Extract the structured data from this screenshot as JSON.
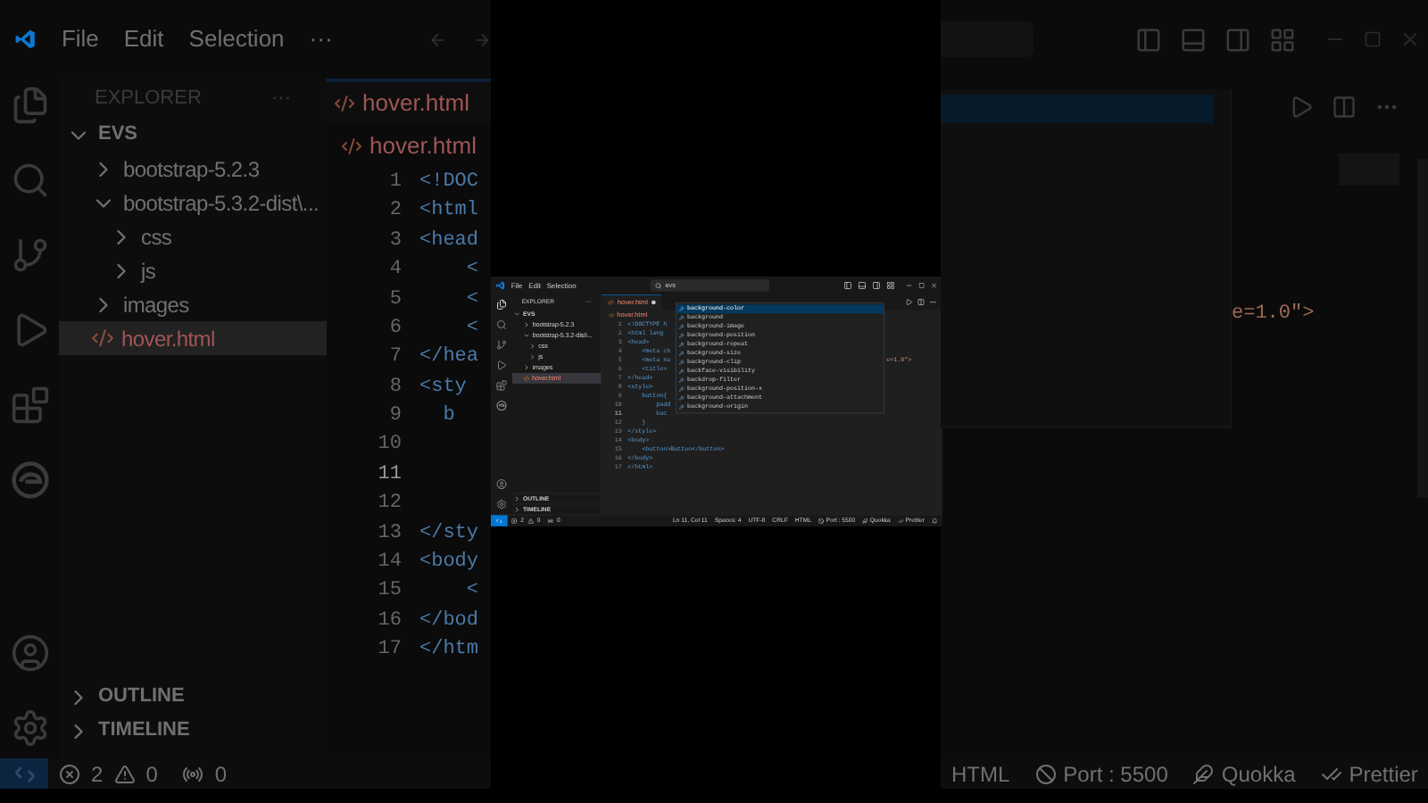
{
  "background": {
    "menu": [
      "File",
      "Edit",
      "Selection",
      "···"
    ],
    "explorer": {
      "title": "EXPLORER",
      "more": "···",
      "workspace": "EVS",
      "workspace_expanded": true,
      "items": [
        {
          "label": "bootstrap-5.2.3",
          "kind": "folder",
          "expanded": false,
          "selected": false
        },
        {
          "label": "bootstrap-5.3.2-dist\\...",
          "kind": "folder",
          "expanded": true,
          "selected": false,
          "children": [
            {
              "label": "css",
              "kind": "folder",
              "expanded": false,
              "selected": false
            },
            {
              "label": "js",
              "kind": "folder",
              "expanded": false,
              "selected": false
            }
          ]
        },
        {
          "label": "images",
          "kind": "folder",
          "expanded": false,
          "selected": false
        },
        {
          "label": "hover.html",
          "kind": "file",
          "has_errors": true,
          "selected": true
        }
      ]
    },
    "sections": [
      "OUTLINE",
      "TIMELINE"
    ],
    "tab": "hover.html",
    "breadcrumb": "hover.html",
    "lines": [
      {
        "number": "1",
        "code": "<!DOC",
        "current": false
      },
      {
        "number": "2",
        "code": "<html",
        "current": false
      },
      {
        "number": "3",
        "code": "<head",
        "current": false
      },
      {
        "number": "4",
        "code": "    <",
        "current": false
      },
      {
        "number": "5",
        "code": "    <",
        "current": false
      },
      {
        "number": "6",
        "code": "    <",
        "current": false
      },
      {
        "number": "7",
        "code": "</hea",
        "current": false
      },
      {
        "number": "8",
        "code": "<sty",
        "current": false
      },
      {
        "number": "9",
        "code": "  b",
        "current": false
      },
      {
        "number": "10",
        "current": false
      },
      {
        "number": "11",
        "current": true
      },
      {
        "number": "12",
        "current": false
      },
      {
        "number": "13",
        "code": "</sty",
        "current": false
      },
      {
        "number": "14",
        "code": "<body",
        "current": false
      },
      {
        "number": "15",
        "code": "    <",
        "current": false
      },
      {
        "number": "16",
        "code": "</bod",
        "current": false
      },
      {
        "number": "17",
        "code": "</htm",
        "current": false
      }
    ],
    "code_tail": "e=1.0\">",
    "status_left": {
      "errors": "2",
      "warnings": "0",
      "ports": "0"
    },
    "status_right": [
      {
        "kind": "language",
        "text": "HTML"
      },
      {
        "kind": "port",
        "text": "Port : 5500"
      },
      {
        "kind": "quokka",
        "text": "Quokka"
      },
      {
        "kind": "prettier",
        "text": "Prettier"
      }
    ]
  },
  "window": {
    "menu": [
      "File",
      "Edit",
      "Selection"
    ],
    "search": "evs",
    "explorer": {
      "title": "EXPLORER",
      "more": "···",
      "workspace": "EVS",
      "workspace_expanded": true,
      "items": [
        {
          "label": "bootstrap-5.2.3",
          "kind": "folder",
          "expanded": false,
          "selected": false
        },
        {
          "label": "bootstrap-5.3.2-dist\\...",
          "kind": "folder",
          "expanded": true,
          "selected": false,
          "children": [
            {
              "label": "css",
              "kind": "folder",
              "expanded": false,
              "selected": false
            },
            {
              "label": "js",
              "kind": "folder",
              "expanded": false,
              "selected": false
            }
          ]
        },
        {
          "label": "images",
          "kind": "folder",
          "expanded": false,
          "selected": false
        },
        {
          "label": "hover.html",
          "kind": "file",
          "has_errors": true,
          "selected": true
        }
      ]
    },
    "sections": [
      "OUTLINE",
      "TIMELINE"
    ],
    "tab": {
      "label": "hover.html",
      "dirty": true
    },
    "breadcrumb": "hover.html",
    "lines": [
      {
        "number": "1",
        "code": "<!DOCTYPE h",
        "current": false
      },
      {
        "number": "2",
        "code": "<html lang",
        "current": false
      },
      {
        "number": "3",
        "code": "<head>",
        "current": false
      },
      {
        "number": "4",
        "code": "    <meta ch",
        "current": false
      },
      {
        "number": "5",
        "code": "    <meta na",
        "tail": "e=1.0\">",
        "current": false
      },
      {
        "number": "6",
        "code": "    <title>",
        "current": false
      },
      {
        "number": "7",
        "code": "</head>",
        "current": false
      },
      {
        "number": "8",
        "code": "<style>",
        "current": false
      },
      {
        "number": "9",
        "code": "    button{",
        "current": false
      },
      {
        "number": "10",
        "code": "        padd",
        "current": false
      },
      {
        "number": "11",
        "code": "        bac",
        "current": true
      },
      {
        "number": "12",
        "code": "    }",
        "current": false
      },
      {
        "number": "13",
        "code": "</style>",
        "current": false
      },
      {
        "number": "14",
        "code": "<body>",
        "current": false
      },
      {
        "number": "15",
        "code": "    <button>Button</button>",
        "current": false
      },
      {
        "number": "16",
        "code": "</body>",
        "current": false
      },
      {
        "number": "17",
        "code": "</html>",
        "current": false
      }
    ],
    "suggestions": [
      {
        "label": "background-color",
        "selected": true
      },
      {
        "label": "background",
        "selected": false
      },
      {
        "label": "background-image",
        "selected": false
      },
      {
        "label": "background-position",
        "selected": false
      },
      {
        "label": "background-repeat",
        "selected": false
      },
      {
        "label": "background-size",
        "selected": false
      },
      {
        "label": "background-clip",
        "selected": false
      },
      {
        "label": "backface-visibility",
        "selected": false
      },
      {
        "label": "backdrop-filter",
        "selected": false
      },
      {
        "label": "background-position-x",
        "selected": false
      },
      {
        "label": "background-attachment",
        "selected": false
      },
      {
        "label": "background-origin",
        "selected": false
      }
    ],
    "status_left": {
      "errors": "2",
      "warnings": "0",
      "ports": "0"
    },
    "status_right": [
      {
        "kind": "cursor",
        "text": "Ln 11, Col 11"
      },
      {
        "kind": "indent",
        "text": "Spaces: 4"
      },
      {
        "kind": "encoding",
        "text": "UTF-8"
      },
      {
        "kind": "eol",
        "text": "CRLF"
      },
      {
        "kind": "language",
        "text": "HTML"
      },
      {
        "kind": "port",
        "text": "Port : 5500"
      },
      {
        "kind": "quokka",
        "text": "Quokka"
      },
      {
        "kind": "prettier",
        "text": "Prettier"
      }
    ]
  }
}
